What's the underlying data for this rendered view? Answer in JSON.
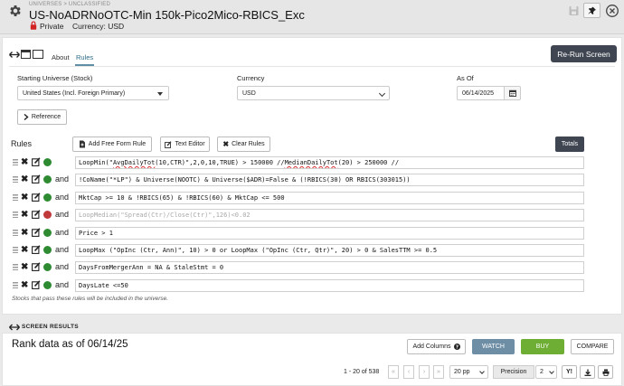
{
  "header": {
    "breadcrumb": "UNIVERSES > UNCLASSIFIED",
    "title": "US-NoADRNoOTC-Min 150k-Pico2Mico-RBICS_Exc",
    "visibility": "Private",
    "currency_label": "Currency: USD"
  },
  "tabs": [
    {
      "label": "About",
      "active": false
    },
    {
      "label": "Rules",
      "active": true
    }
  ],
  "rerun_label": "Re-Run Screen",
  "form": {
    "starting_universe_label": "Starting Universe (Stock)",
    "starting_universe_value": "United States (Incl. Foreign Primary)",
    "currency_label": "Currency",
    "currency_value": "USD",
    "as_of_label": "As Of",
    "as_of_value": "06/14/2025",
    "reference_label": "Reference"
  },
  "rules_section": {
    "heading": "Rules",
    "add_free_form_label": "Add Free Form Rule",
    "text_editor_label": "Text Editor",
    "clear_rules_label": "Clear Rules",
    "totals_label": "Totals",
    "note": "Stocks that pass these rules will be included in the universe.",
    "rules": [
      {
        "conj": "",
        "status": "enabled",
        "status_color": "#2e8b32",
        "text_a": "LoopMin(\"",
        "squig_a": "AvgDailyTot",
        "text_b": "(10,CTR)\",2,0,10,TRUE) > 150000 //",
        "squig_b": "MedianDailyTot",
        "text_c": "(20) > 250000 //"
      },
      {
        "conj": "and",
        "status": "enabled",
        "status_color": "#2e8b32",
        "text": "!CoName(\"*LP\") & Universe(NOOTC) & Universe($ADR)=False & (!RBICS(30) OR RBICS(303015))"
      },
      {
        "conj": "and",
        "status": "enabled",
        "status_color": "#2e8b32",
        "text": "MktCap >= 10 & !RBICS(65) & !RBICS(60) & MktCap <= 500"
      },
      {
        "conj": "and",
        "status": "disabled",
        "status_color": "#c0393b",
        "text": "LoopMedian(\"Spread(Ctr)/Close(Ctr)\",126)<0.02"
      },
      {
        "conj": "and",
        "status": "enabled",
        "status_color": "#2e8b32",
        "text": "Price > 1"
      },
      {
        "conj": "and",
        "status": "enabled",
        "status_color": "#2e8b32",
        "text": "LoopMax (\"OpInc (Ctr, Ann)\", 10) > 0 or LoopMax (\"OpInc (Ctr, Qtr)\", 20) > 0 & SalesTTM >= 0.5"
      },
      {
        "conj": "and",
        "status": "enabled",
        "status_color": "#2e8b32",
        "text": "DaysFromMergerAnn = NA & StaleStmt = 0"
      },
      {
        "conj": "and",
        "status": "enabled",
        "status_color": "#2e8b32",
        "text": "DaysLate <=50"
      }
    ]
  },
  "results": {
    "section_title": "SCREEN RESULTS",
    "rank_text": "Rank data as of 06/14/25",
    "add_columns_label": "Add Columns",
    "watch_label": "WATCH",
    "buy_label": "BUY",
    "compare_label": "COMPARE",
    "pager_text": "1 - 20 of 538",
    "pager_first": "«",
    "pager_prev": "‹",
    "pager_next": "›",
    "pager_last": "»",
    "per_page_value": "20 pp",
    "precision_label": "Precision",
    "precision_value": "2",
    "y_label": "Y!"
  },
  "colors": {
    "dark_button": "#3f4651",
    "watch": "#6e8ea5",
    "buy": "#6fae34",
    "enabled": "#2e8b32",
    "disabled": "#c0393b"
  }
}
